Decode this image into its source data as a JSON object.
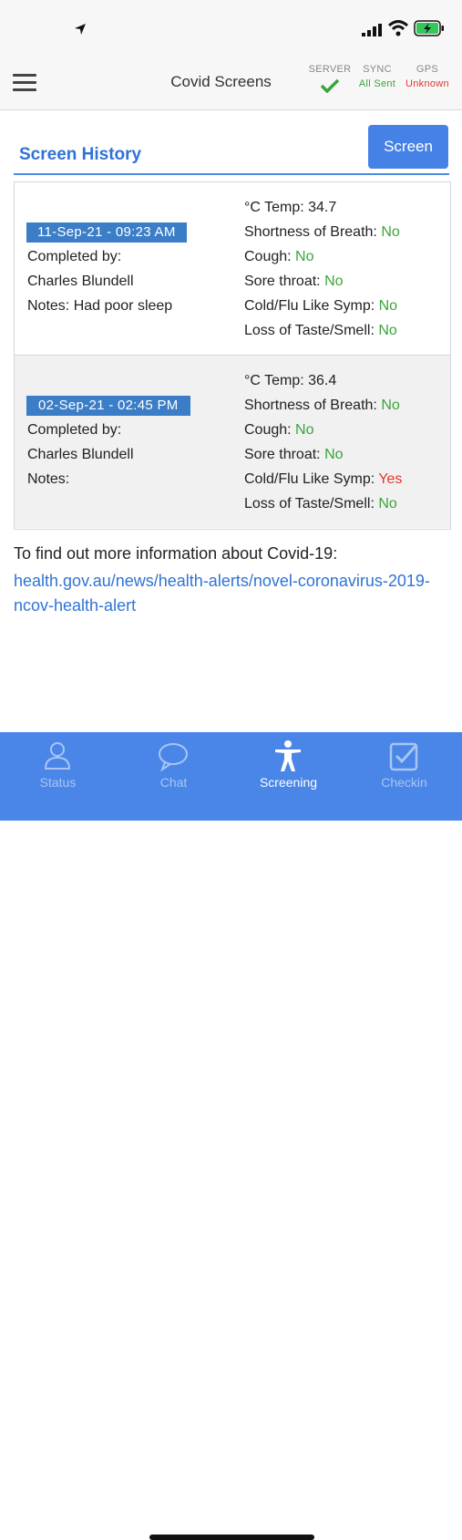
{
  "header": {
    "title": "Covid Screens",
    "status": [
      {
        "label": "SERVER",
        "value": ""
      },
      {
        "label": "SYNC",
        "value": "All Sent"
      },
      {
        "label": "GPS",
        "value": "Unknown"
      }
    ]
  },
  "section": {
    "title": "Screen History",
    "screen_button": "Screen"
  },
  "entries": [
    {
      "date": "11-Sep-21 - 09:23 AM",
      "completed_by_label": "Completed by:",
      "completed_by": "Charles Blundell",
      "notes": "Notes: Had poor sleep",
      "temp": "°C Temp: 34.7",
      "breath_label": "Shortness of Breath:",
      "breath": "No",
      "cough_label": "Cough:",
      "cough": "No",
      "throat_label": "Sore throat:",
      "throat": "No",
      "cold_label": "Cold/Flu Like Symp:",
      "cold": "No",
      "taste_label": "Loss of Taste/Smell:",
      "taste": "No"
    },
    {
      "date": "02-Sep-21 - 02:45 PM",
      "completed_by_label": "Completed by:",
      "completed_by": "Charles Blundell",
      "notes": "Notes:",
      "temp": "°C Temp: 36.4",
      "breath_label": "Shortness of Breath:",
      "breath": "No",
      "cough_label": "Cough:",
      "cough": "No",
      "throat_label": "Sore throat:",
      "throat": "No",
      "cold_label": "Cold/Flu Like Symp:",
      "cold": "Yes",
      "taste_label": "Loss of Taste/Smell:",
      "taste": "No"
    }
  ],
  "info": {
    "text": "To find out more information about Covid-19:",
    "link": "health.gov.au/news/health-alerts/novel-coronavirus-2019-ncov-health-alert"
  },
  "tabs": [
    {
      "label": "Status",
      "icon": "person-icon"
    },
    {
      "label": "Chat",
      "icon": "chat-bubble-icon"
    },
    {
      "label": "Screening",
      "icon": "body-icon",
      "active": true
    },
    {
      "label": "Checkin",
      "icon": "checkbox-icon"
    }
  ],
  "colors": {
    "accent": "#4a86e8",
    "badge": "#3b7dc7",
    "ok": "#3aa53a",
    "alert": "#e0362f"
  }
}
